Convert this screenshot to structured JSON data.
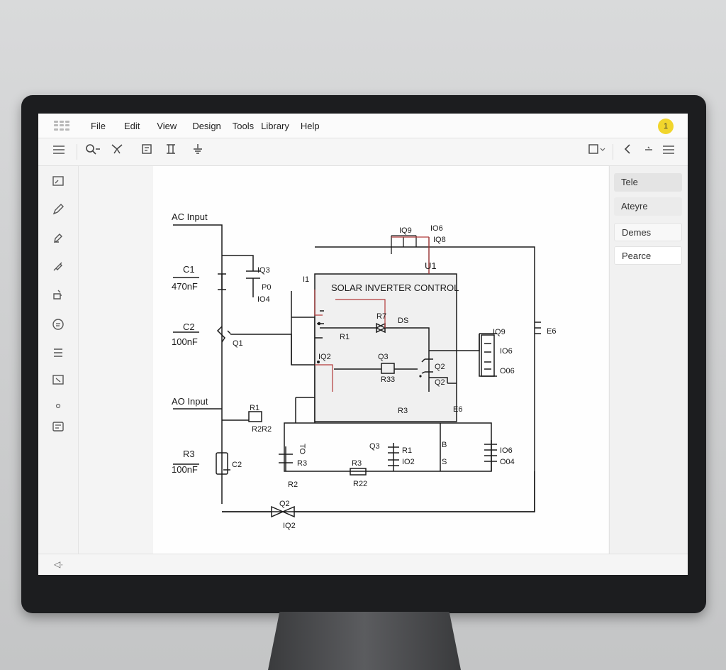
{
  "menu": {
    "items": [
      "File",
      "Edit",
      "View",
      "Design",
      "Tools",
      "Library",
      "Help"
    ],
    "notification_count": "1"
  },
  "toolbar": {
    "left_icons": [
      "menu-icon",
      "zoom-icon",
      "wire-tool-icon",
      "frame-icon",
      "component-icon",
      "ground-icon"
    ],
    "right_icons": [
      "view-select-icon",
      "back-icon",
      "collapse-icon",
      "menu-icon"
    ]
  },
  "sidebar": {
    "icons": [
      "select-tool-icon",
      "pencil-icon",
      "pen-icon",
      "probe-icon",
      "paint-icon",
      "chat-icon",
      "list-icon",
      "frame-icon",
      "dot-icon",
      "properties-icon"
    ]
  },
  "right_panel": {
    "items": [
      "Tele",
      "Ateyre",
      "Demes",
      "Pearce"
    ]
  },
  "status": {
    "text": "◁·"
  },
  "schematic": {
    "labels": {
      "ac_input": "AC Input",
      "c1": "C1",
      "c1_value": "470nF",
      "c2": "C2",
      "c2_value": "100nF",
      "q1": "Q1",
      "ao_input": "AO Input",
      "r1_left": "R1",
      "r2r2": "R2R2",
      "r3_left": "R3",
      "r3_value": "100nF",
      "c2_bottom": "C2",
      "r2_bottom": "R2",
      "q2_bottom": "Q2",
      "iq2": "IQ2",
      "q3_cap": "IQ3",
      "p0": "P0",
      "io4": "IO4",
      "i1": "I1",
      "iq9": "IQ9",
      "io6_top": "IO6",
      "iq8": "IQ8",
      "u1": "U1",
      "block_title": "SOLAR INVERTER CONTROL",
      "r7": "R7",
      "ds": "DS",
      "r1_inner": "R1",
      "iq2_inner": "IQ2",
      "q3_inner": "Q3",
      "r33": "R33",
      "q2_a": "Q2",
      "q2_b": "Q2",
      "r3_block": "R3",
      "e6": "E6",
      "e6_right": "E6",
      "iq9_right": "IQ9",
      "io6_right": "IO6",
      "o06": "O06",
      "to": "TO",
      "r3_lower": "R3",
      "q3_lower": "Q3",
      "r1_lower": "R1",
      "io2": "IO2",
      "r3_res": "R3",
      "r22": "R22",
      "b_label": "B",
      "s_label": "S",
      "io6_lower": "IO6",
      "o04": "O04"
    }
  }
}
